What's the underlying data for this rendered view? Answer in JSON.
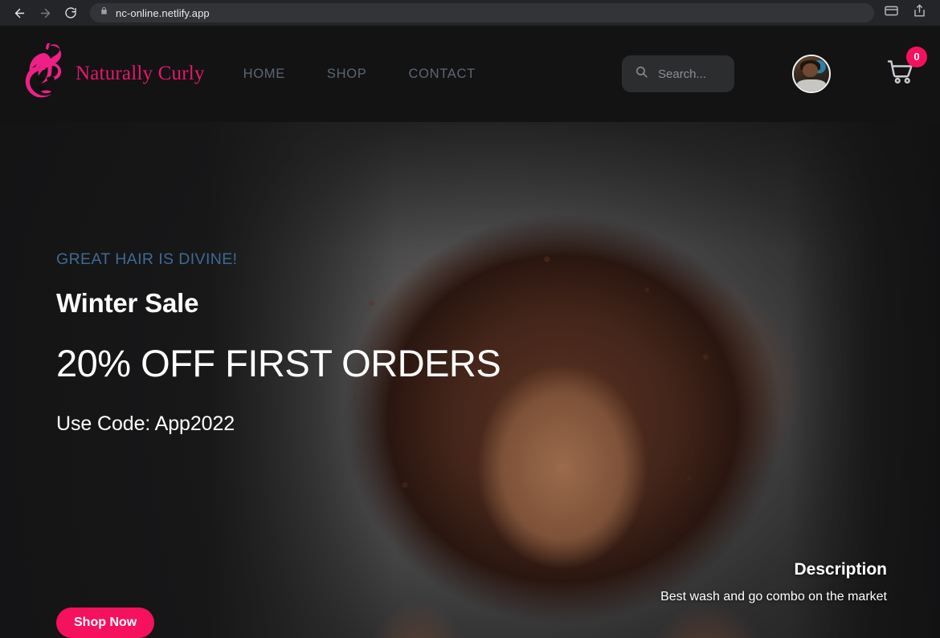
{
  "browser": {
    "back_icon": "back-arrow-icon",
    "forward_icon": "forward-arrow-icon",
    "reload_icon": "reload-icon",
    "lock_icon": "lock-icon",
    "url": "nc-online.netlify.app",
    "payment_icon": "payment-card-icon",
    "share_icon": "share-icon"
  },
  "header": {
    "brand_name": "Naturally Curly",
    "brand_color": "#e8176b",
    "nav": [
      {
        "label": "HOME"
      },
      {
        "label": "SHOP"
      },
      {
        "label": "CONTACT"
      }
    ],
    "search": {
      "placeholder": "Search...",
      "icon": "search-icon"
    },
    "avatar_alt": "user-avatar",
    "cart": {
      "icon": "shopping-cart-icon",
      "count": "0",
      "badge_color": "#f5115e"
    }
  },
  "hero": {
    "eyebrow": "GREAT HAIR IS DIVINE!",
    "eyebrow_color": "#3d6a96",
    "title": "Winter Sale",
    "headline": "20% OFF FIRST ORDERS",
    "code_line": "Use Code: App2022",
    "cta_label": "Shop Now",
    "cta_color": "#f5115e",
    "description_title": "Description",
    "description_text": "Best wash and go combo on the market"
  }
}
